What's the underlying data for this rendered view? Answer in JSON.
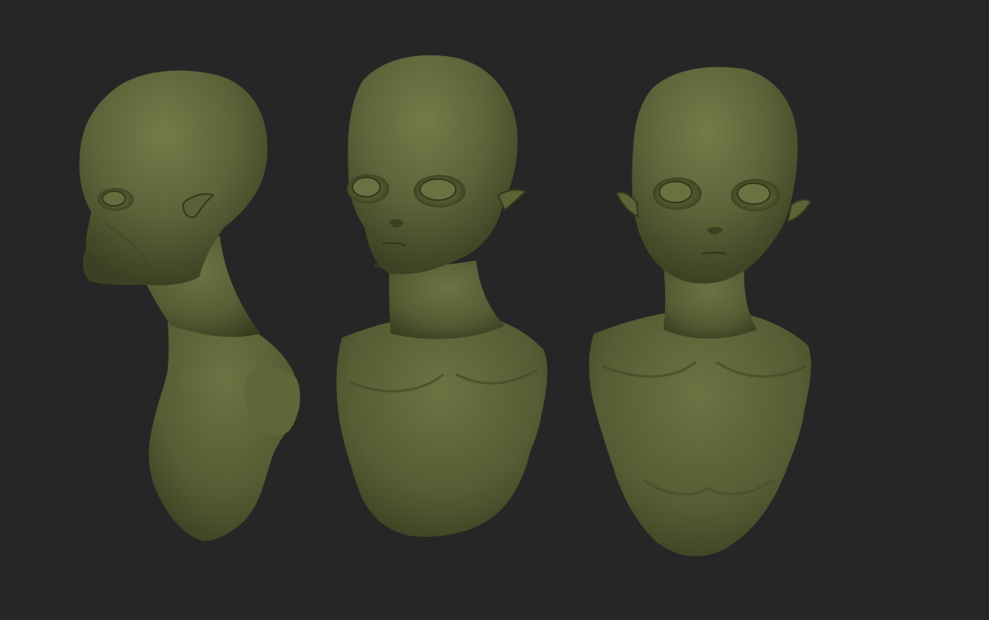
{
  "scene": {
    "background_color": "#262626",
    "material_color": "#5c6339",
    "material_highlight": "#747c4a",
    "material_shadow": "#2f3319",
    "views": [
      {
        "name": "alien-bust-side-view"
      },
      {
        "name": "alien-bust-three-quarter-view"
      },
      {
        "name": "alien-bust-front-view"
      }
    ]
  }
}
